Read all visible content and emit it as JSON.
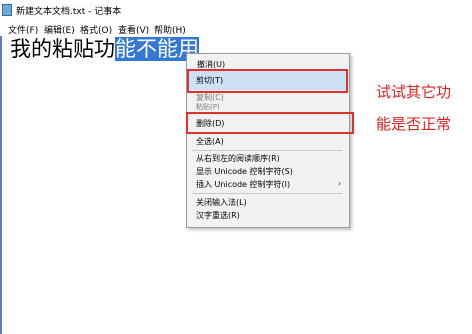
{
  "window": {
    "title": "新建文本文档.txt - 记事本"
  },
  "menubar": [
    "文件(F)",
    "编辑(E)",
    "格式(O)",
    "查看(V)",
    "帮助(H)"
  ],
  "editor": {
    "text_plain": "我的粘贴功",
    "text_selected": "能不能用"
  },
  "context_menu": {
    "undo": "撤消(U)",
    "cut": "剪切(T)",
    "copy": "复制(C)",
    "paste": "粘贴(P)",
    "delete": "删除(D)",
    "select_all": "全选(A)",
    "rtl": "从右到左的阅读顺序(R)",
    "show_unicode": "显示 Unicode 控制字符(S)",
    "insert_unicode": "插入 Unicode 控制字符(I)",
    "close_ime": "关闭输入法(L)",
    "reconvert": "汉字重选(R)",
    "submenu_arrow": "›"
  },
  "annotation": {
    "line1": "试试其它功",
    "line2": "能是否正常"
  },
  "colors": {
    "selection": "#3478d4",
    "highlight_box": "#e03030",
    "annotation_text": "#e02020"
  }
}
